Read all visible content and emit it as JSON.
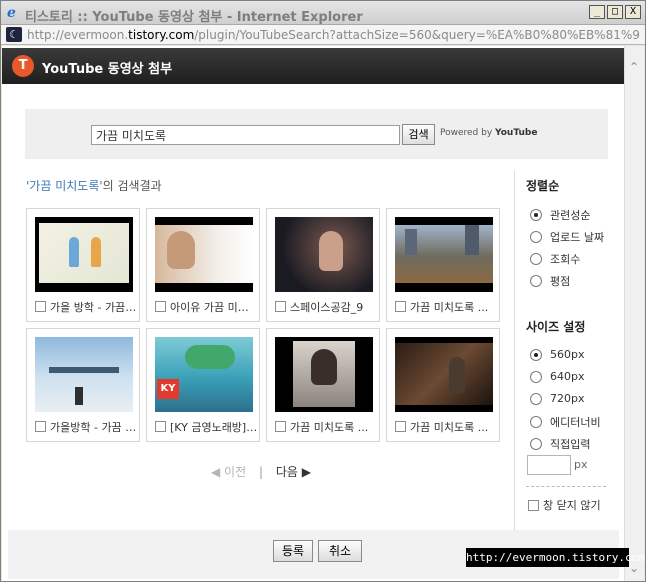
{
  "window": {
    "title": "티스토리 :: YouTube 동영상 첨부 - Internet Explorer",
    "buttons": [
      "_",
      "□",
      "X"
    ]
  },
  "address": {
    "prefix": "http://evermoon.",
    "domain": "tistory.com",
    "suffix": "/plugin/YouTubeSearch?attachSize=560&query=%EA%B0%80%EB%81%94+%EB%"
  },
  "header": {
    "logo": "T",
    "title": "YouTube 동영상 첨부"
  },
  "search": {
    "value": "가끔 미치도록",
    "button": "검색",
    "powered_by": "Powered by",
    "powered_brand": "YouTube"
  },
  "results": {
    "quote_open": "'가끔 미치도록'",
    "suffix": "의 검색결과",
    "items": [
      {
        "caption": "가을 방학 - 가끔 미치도록"
      },
      {
        "caption": "아이유 가끔 미치도록"
      },
      {
        "caption": "스페이스공감_9"
      },
      {
        "caption": "가끔 미치도록 ..."
      },
      {
        "caption": "가을방학 - 가끔 미치도록"
      },
      {
        "caption": "[KY 금영노래방] 가끔 미치도록"
      },
      {
        "caption": "가끔 미치도록 ..."
      },
      {
        "caption": "가끔 미치도록 ..."
      }
    ]
  },
  "pager": {
    "prev": "◀ 이전",
    "separator": "|",
    "next": "다음 ▶"
  },
  "sidebar": {
    "sort_title": "정렬순",
    "sort_options": [
      {
        "label": "관련성순",
        "selected": true
      },
      {
        "label": "업로드 날짜",
        "selected": false
      },
      {
        "label": "조회수",
        "selected": false
      },
      {
        "label": "평점",
        "selected": false
      }
    ],
    "size_title": "사이즈 설정",
    "size_options": [
      {
        "label": "560px",
        "selected": true
      },
      {
        "label": "640px",
        "selected": false
      },
      {
        "label": "720px",
        "selected": false
      },
      {
        "label": "에디터너비",
        "selected": false
      },
      {
        "label": "직접입력",
        "selected": false
      }
    ],
    "px_unit": "px",
    "keep_open": "창 닫지 않기"
  },
  "footer": {
    "register": "등록",
    "cancel": "취소"
  },
  "watermark": "http://evermoon.tistory.com",
  "colors": {
    "header_bg": "#2a2a2a",
    "logo_bg": "#e8582a",
    "link_blue": "#3c78b5"
  }
}
